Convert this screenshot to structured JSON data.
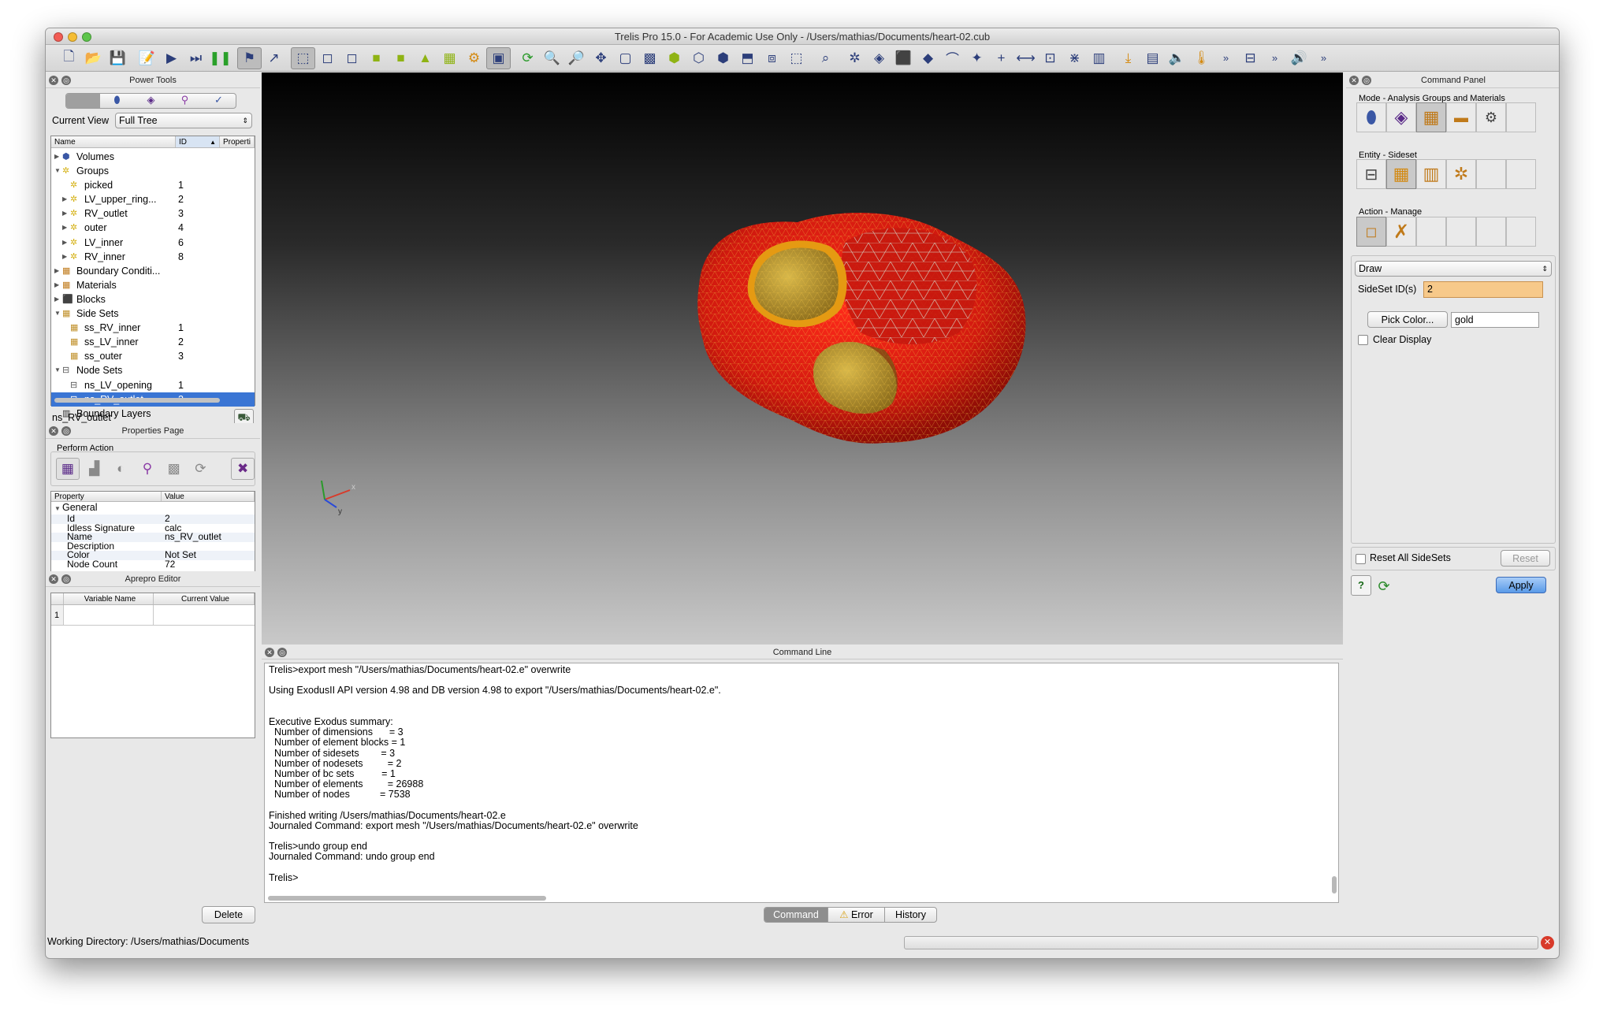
{
  "window": {
    "title": "Trelis Pro 15.0 - For Academic Use Only - /Users/mathias/Documents/heart-02.cub"
  },
  "power_tools": {
    "title": "Power Tools",
    "current_view_label": "Current View",
    "current_view_value": "Full Tree",
    "columns": [
      "Name",
      "ID",
      "Properti"
    ],
    "rows": [
      {
        "label": "Volumes",
        "id": "",
        "indent": 0,
        "icon": "volume-icon"
      },
      {
        "label": "Groups",
        "id": "",
        "indent": 0,
        "icon": "group-icon"
      },
      {
        "label": "picked",
        "id": "1",
        "indent": 1,
        "icon": "group-icon"
      },
      {
        "label": "LV_upper_ring...",
        "id": "2",
        "indent": 1,
        "icon": "group-icon"
      },
      {
        "label": "RV_outlet",
        "id": "3",
        "indent": 1,
        "icon": "group-icon"
      },
      {
        "label": "outer",
        "id": "4",
        "indent": 1,
        "icon": "group-icon"
      },
      {
        "label": "LV_inner",
        "id": "6",
        "indent": 1,
        "icon": "group-icon"
      },
      {
        "label": "RV_inner",
        "id": "8",
        "indent": 1,
        "icon": "group-icon"
      },
      {
        "label": "Boundary Conditi...",
        "id": "",
        "indent": 0,
        "icon": "boundary-condition-icon"
      },
      {
        "label": "Materials",
        "id": "",
        "indent": 0,
        "icon": "material-icon"
      },
      {
        "label": "Blocks",
        "id": "",
        "indent": 0,
        "icon": "block-icon"
      },
      {
        "label": "Side Sets",
        "id": "",
        "indent": 0,
        "icon": "sideset-icon"
      },
      {
        "label": "ss_RV_inner",
        "id": "1",
        "indent": 1,
        "icon": "sideset-icon"
      },
      {
        "label": "ss_LV_inner",
        "id": "2",
        "indent": 1,
        "icon": "sideset-icon"
      },
      {
        "label": "ss_outer",
        "id": "3",
        "indent": 1,
        "icon": "sideset-icon"
      },
      {
        "label": "Node Sets",
        "id": "",
        "indent": 0,
        "icon": "nodeset-icon"
      },
      {
        "label": "ns_LV_opening",
        "id": "1",
        "indent": 1,
        "icon": "nodeset-icon"
      },
      {
        "label": "ns_RV_outlet",
        "id": "2",
        "indent": 1,
        "icon": "nodeset-icon",
        "selected": true
      },
      {
        "label": "Boundary Layers",
        "id": "",
        "indent": 0,
        "icon": "boundary-layer-icon"
      }
    ],
    "selected_name": "ns_RV_outlet"
  },
  "properties": {
    "title": "Properties Page",
    "perform_action": "Perform Action",
    "columns": [
      "Property",
      "Value"
    ],
    "group": "General",
    "rows": [
      {
        "k": "Id",
        "v": "2"
      },
      {
        "k": "Idless Signature",
        "v": "calc"
      },
      {
        "k": "Name",
        "v": "ns_RV_outlet"
      },
      {
        "k": "Description",
        "v": ""
      },
      {
        "k": "Color",
        "v": "Not Set"
      },
      {
        "k": "Node Count",
        "v": "72"
      }
    ]
  },
  "aprepro": {
    "title": "Aprepro Editor",
    "columns": [
      "Variable Name",
      "Current Value"
    ],
    "row_number": "1",
    "delete_label": "Delete"
  },
  "status": {
    "working_directory": "Working Directory: /Users/mathias/Documents"
  },
  "command_line": {
    "title": "Command Line",
    "lines": [
      "Trelis>export mesh \"/Users/mathias/Documents/heart-02.e\" overwrite",
      "",
      "Using ExodusII API version 4.98 and DB version 4.98 to export \"/Users/mathias/Documents/heart-02.e\".",
      "",
      "",
      "Executive Exodus summary:",
      "  Number of dimensions      = 3",
      "  Number of element blocks = 1",
      "  Number of sidesets        = 3",
      "  Number of nodesets         = 2",
      "  Number of bc sets          = 1",
      "  Number of elements         = 26988",
      "  Number of nodes           = 7538",
      "",
      "Finished writing /Users/mathias/Documents/heart-02.e",
      "Journaled Command: export mesh \"/Users/mathias/Documents/heart-02.e\" overwrite",
      "",
      "Trelis>undo group end",
      "Journaled Command: undo group end",
      "",
      "Trelis>"
    ],
    "tabs": [
      "Command",
      "Error",
      "History"
    ]
  },
  "command_panel": {
    "title": "Command Panel",
    "mode_label": "Mode - Analysis Groups and Materials",
    "entity_label": "Entity - Sideset",
    "action_label": "Action - Manage",
    "draw_value": "Draw",
    "sideset_label": "SideSet ID(s)",
    "sideset_value": "2",
    "pick_color_label": "Pick Color...",
    "color_value": "gold",
    "clear_display_label": "Clear Display",
    "reset_all_label": "Reset All SideSets",
    "reset_label": "Reset",
    "apply_label": "Apply"
  },
  "colors": {
    "accent": "#3a75d4",
    "mesh_red": "#d21a0f",
    "mesh_gold": "#c9a42a",
    "sideset_field": "#f7c98a"
  }
}
